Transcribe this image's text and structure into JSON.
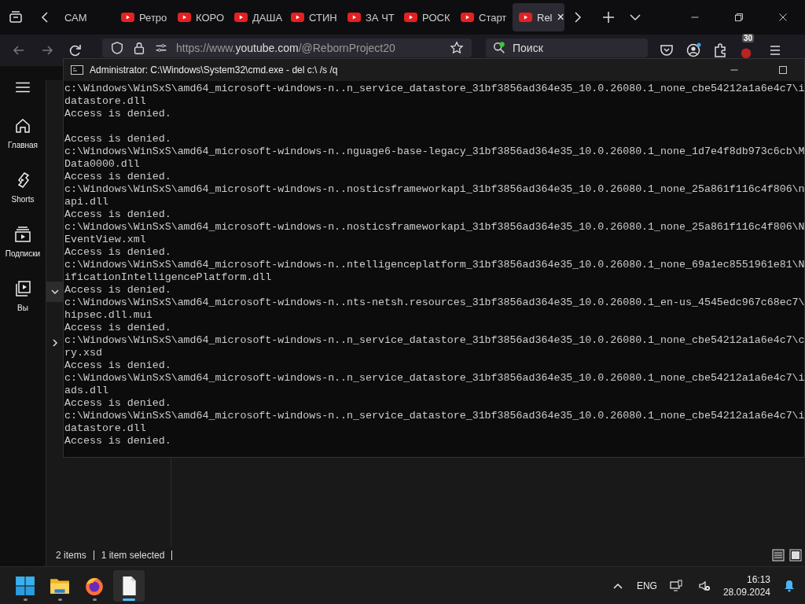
{
  "browser": {
    "tabs": [
      {
        "label": "САМ",
        "kind": "plain",
        "selected": false
      },
      {
        "label": "Ретро",
        "kind": "youtube",
        "selected": false
      },
      {
        "label": "КОРО",
        "kind": "youtube",
        "selected": false
      },
      {
        "label": "ДАША",
        "kind": "youtube",
        "selected": false
      },
      {
        "label": "СТИН",
        "kind": "youtube",
        "selected": false
      },
      {
        "label": "ЗА ЧТ",
        "kind": "youtube",
        "selected": false
      },
      {
        "label": "РОСК",
        "kind": "youtube",
        "selected": false
      },
      {
        "label": "Старт",
        "kind": "youtube",
        "selected": false
      },
      {
        "label": "Rel",
        "kind": "youtube",
        "selected": true
      }
    ],
    "tab_close": "×",
    "url": {
      "prefix": "https://www.",
      "host": "youtube.com",
      "path": "/@RebornProject20"
    },
    "search": {
      "placeholder": "Поиск"
    },
    "extension_badge": "30"
  },
  "youtube_sidebar": {
    "items": [
      {
        "label": "Главная",
        "kind": "home"
      },
      {
        "label": "Shorts",
        "kind": "shorts"
      },
      {
        "label": "Подписки",
        "kind": "subscriptions"
      },
      {
        "label": "Вы",
        "kind": "you"
      }
    ]
  },
  "cmd": {
    "title": "Administrator: C:\\Windows\\System32\\cmd.exe - del  c:\\ /s /q",
    "blocks": [
      [
        "c:\\Windows\\WinSxS\\amd64_microsoft-windows-n..n_service_datastore_31bf3856ad364e35_10.0.26080.1_none_cbe54212a1a6e4c7\\i",
        "datastore.dll",
        "Access is denied."
      ],
      [
        "Access is denied.",
        "c:\\Windows\\WinSxS\\amd64_microsoft-windows-n..nguage6-base-legacy_31bf3856ad364e35_10.0.26080.1_none_1d7e4f8db973c6cb\\M",
        "Data0000.dll",
        "Access is denied.",
        "c:\\Windows\\WinSxS\\amd64_microsoft-windows-n..nosticsframeworkapi_31bf3856ad364e35_10.0.26080.1_none_25a861f116c4f806\\n",
        "api.dll",
        "Access is denied.",
        "c:\\Windows\\WinSxS\\amd64_microsoft-windows-n..nosticsframeworkapi_31bf3856ad364e35_10.0.26080.1_none_25a861f116c4f806\\N",
        "EventView.xml",
        "Access is denied.",
        "c:\\Windows\\WinSxS\\amd64_microsoft-windows-n..ntelligenceplatform_31bf3856ad364e35_10.0.26080.1_none_69a1ec8551961e81\\N",
        "ificationIntelligencePlatform.dll",
        "Access is denied.",
        "c:\\Windows\\WinSxS\\amd64_microsoft-windows-n..nts-netsh.resources_31bf3856ad364e35_10.0.26080.1_en-us_4545edc967c68ec7\\",
        "hipsec.dll.mui",
        "Access is denied.",
        "c:\\Windows\\WinSxS\\amd64_microsoft-windows-n..n_service_datastore_31bf3856ad364e35_10.0.26080.1_none_cbe54212a1a6e4c7\\c",
        "ry.xsd",
        "Access is denied.",
        "c:\\Windows\\WinSxS\\amd64_microsoft-windows-n..n_service_datastore_31bf3856ad364e35_10.0.26080.1_none_cbe54212a1a6e4c7\\i",
        "ads.dll",
        "Access is denied.",
        "c:\\Windows\\WinSxS\\amd64_microsoft-windows-n..n_service_datastore_31bf3856ad364e35_10.0.26080.1_none_cbe54212a1a6e4c7\\i",
        "datastore.dll",
        "Access is denied."
      ]
    ]
  },
  "explorer": {
    "status": [
      "2 items",
      "1 item selected"
    ]
  },
  "taskbar": {
    "apps": [
      {
        "kind": "start",
        "active": false
      },
      {
        "kind": "folder",
        "active": false
      },
      {
        "kind": "firefox",
        "active": false
      },
      {
        "kind": "file",
        "active": true
      }
    ],
    "language": "ENG",
    "time": "16:13",
    "date": "28.09.2024"
  }
}
